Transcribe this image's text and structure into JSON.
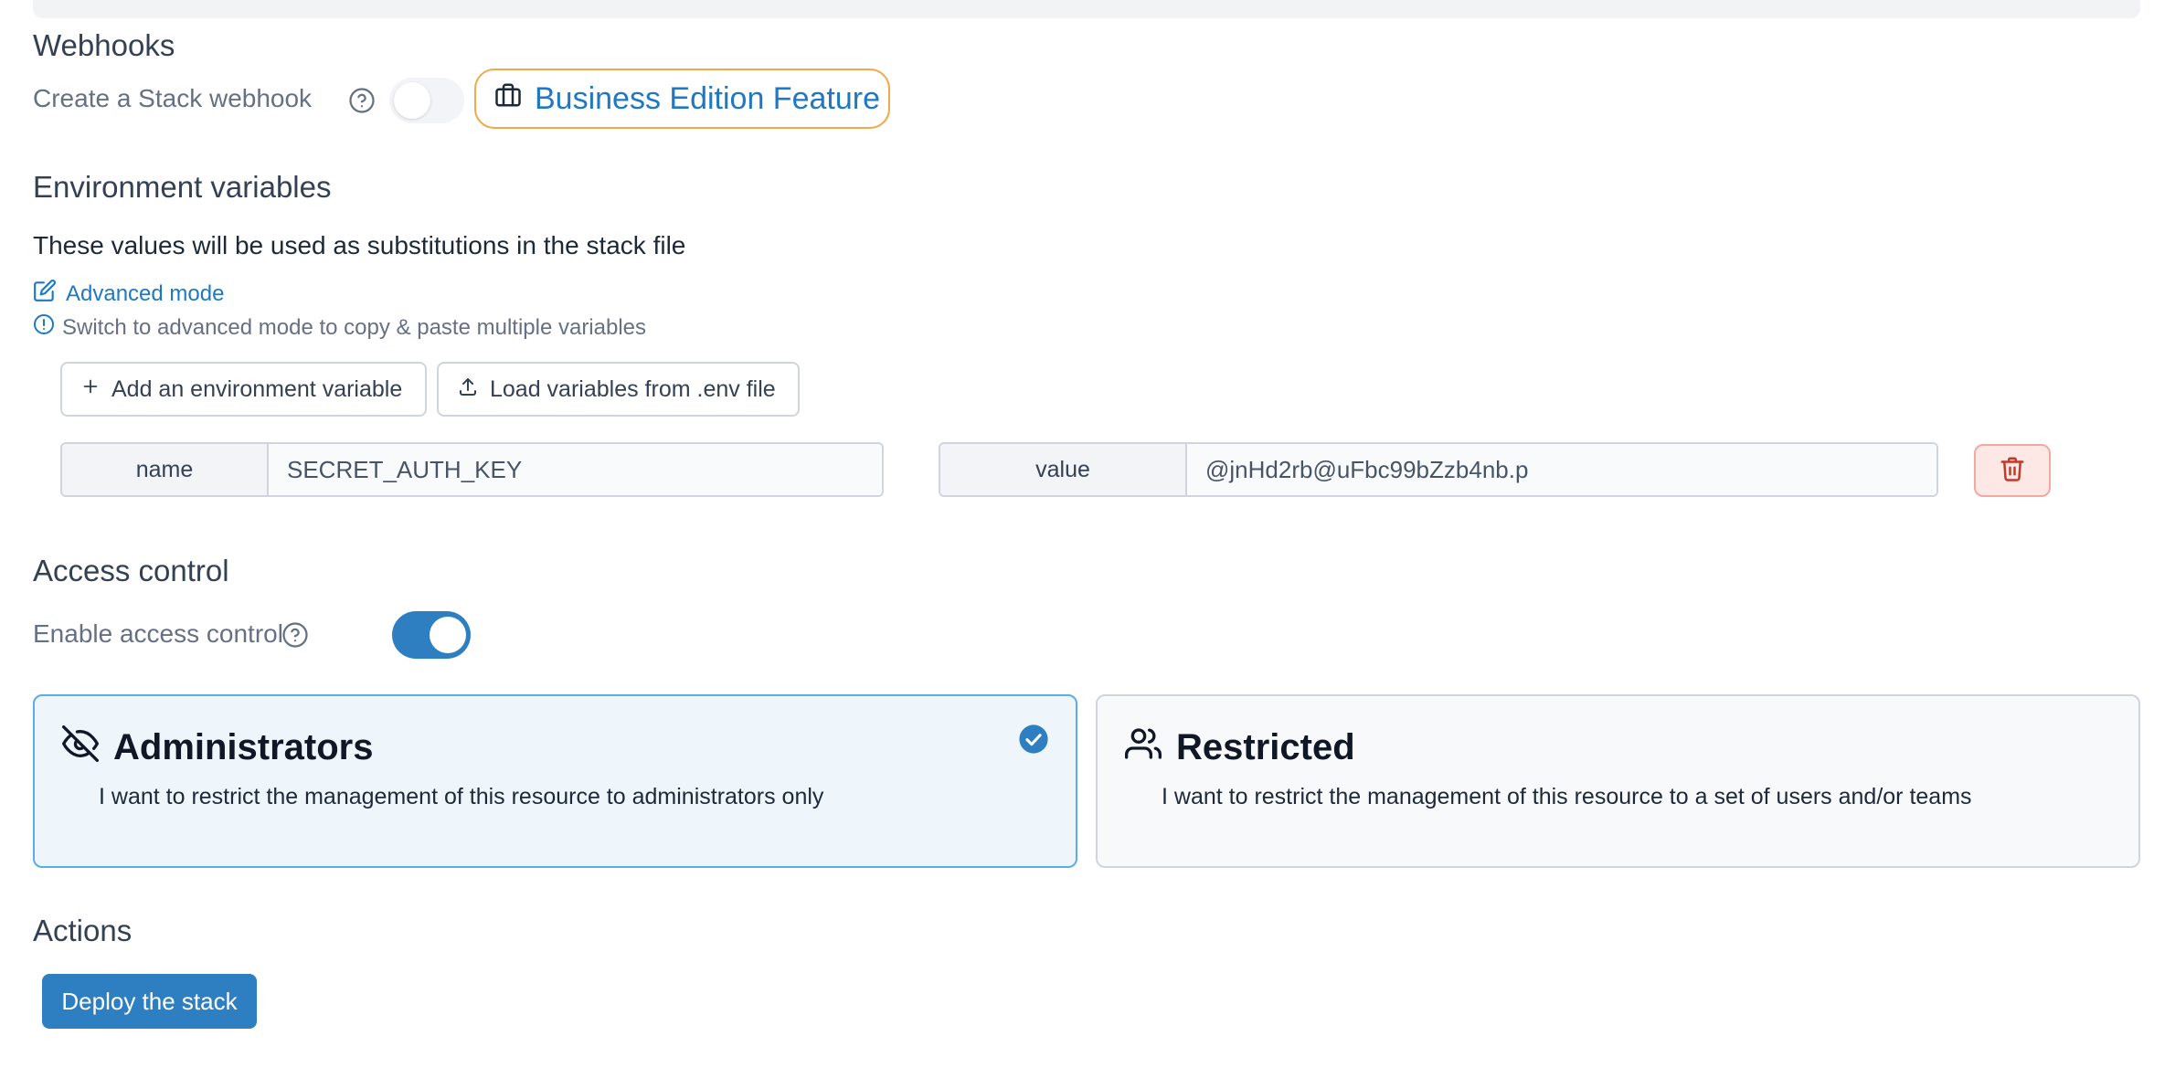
{
  "webhooks": {
    "title": "Webhooks",
    "create_label": "Create a Stack webhook",
    "business_badge": "Business Edition Feature",
    "toggle_enabled": false
  },
  "env": {
    "title": "Environment variables",
    "description": "These values will be used as substitutions in the stack file",
    "advanced_link": "Advanced mode",
    "hint": "Switch to advanced mode to copy & paste multiple variables",
    "add_button": "Add an environment variable",
    "load_button": "Load variables from .env file",
    "rows": [
      {
        "name_label": "name",
        "name_value": "SECRET_AUTH_KEY",
        "value_label": "value",
        "value_value": "@jnHd2rb@uFbc99bZzb4nb.p"
      }
    ]
  },
  "access": {
    "title": "Access control",
    "enable_label": "Enable access control",
    "toggle_enabled": true,
    "options": [
      {
        "title": "Administrators",
        "description": "I want to restrict the management of this resource to administrators only",
        "selected": true,
        "icon": "eye-off-icon"
      },
      {
        "title": "Restricted",
        "description": "I want to restrict the management of this resource to a set of users and/or teams",
        "selected": false,
        "icon": "users-icon"
      }
    ]
  },
  "actions": {
    "title": "Actions",
    "deploy_button": "Deploy the stack"
  },
  "colors": {
    "accent": "#2e7fc2",
    "link": "#1f78c1",
    "badge_border": "#f0a94a",
    "danger": "#c0392b"
  }
}
